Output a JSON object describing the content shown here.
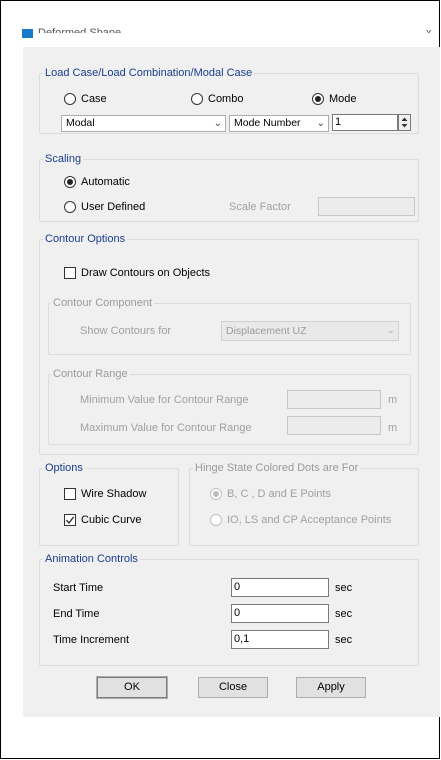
{
  "window": {
    "title": "Deformed Shape",
    "close": "x"
  },
  "load_case": {
    "group_label": "Load Case/Load Combination/Modal Case",
    "options": [
      {
        "label": "Case",
        "checked": false
      },
      {
        "label": "Combo",
        "checked": false
      },
      {
        "label": "Mode",
        "checked": true
      }
    ],
    "case_select": "Modal",
    "mode_select": "Mode Number",
    "mode_number": "1"
  },
  "scaling": {
    "group_label": "Scaling",
    "automatic": "Automatic",
    "user_defined": "User Defined",
    "scale_factor_label": "Scale Factor",
    "scale_factor_value": ""
  },
  "contour_options": {
    "group_label": "Contour Options",
    "draw_contours": "Draw Contours on Objects",
    "component": {
      "group_label": "Contour Component",
      "show_label": "Show Contours for",
      "show_value": "Displacement UZ"
    },
    "range": {
      "group_label": "Contour Range",
      "min_label": "Minimum Value for Contour Range",
      "max_label": "Maximum Value for Contour Range",
      "min_value": "",
      "max_value": "",
      "unit": "m"
    }
  },
  "options": {
    "group_label": "Options",
    "wire_shadow": "Wire Shadow",
    "wire_shadow_checked": false,
    "cubic_curve": "Cubic Curve",
    "cubic_curve_checked": true
  },
  "hinge": {
    "group_label": "Hinge State Colored Dots are For",
    "option1": "B, C , D and E Points",
    "option2": "IO, LS and CP Acceptance Points"
  },
  "animation": {
    "group_label": "Animation Controls",
    "rows": [
      {
        "label": "Start Time",
        "value": "0",
        "unit": "sec"
      },
      {
        "label": "End Time",
        "value": "0",
        "unit": "sec"
      },
      {
        "label": "Time Increment",
        "value": "0,1",
        "unit": "sec"
      }
    ]
  },
  "buttons": {
    "ok": "OK",
    "close": "Close",
    "apply": "Apply"
  }
}
